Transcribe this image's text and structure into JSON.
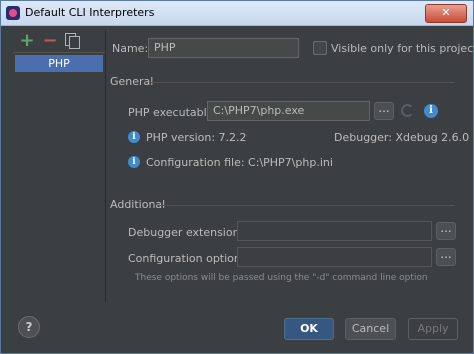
{
  "window": {
    "title": "Default CLI Interpreters",
    "close_glyph": "✕"
  },
  "toolbar": {
    "add_icon": "plus-icon",
    "remove_icon": "minus-icon",
    "copy_icon": "copy-icon"
  },
  "interpreters": [
    {
      "label": "PHP"
    }
  ],
  "form": {
    "name_label": "Name:",
    "name_value": "PHP",
    "visible_only_label": "Visible only for this project",
    "visible_only_checked": false,
    "general_heading": "General",
    "php_executable_label": "PHP executable:",
    "php_executable_value": "C:\\PHP7\\php.exe",
    "php_version": "PHP version: 7.2.2",
    "debugger": "Debugger: Xdebug 2.6.0",
    "config_file": "Configuration file: C:\\PHP7\\php.ini",
    "additional_heading": "Additional",
    "debugger_extension_label": "Debugger extension:",
    "debugger_extension_value": "",
    "configuration_options_label": "Configuration options:",
    "configuration_options_value": "",
    "hint": "These options will be passed using the \"-d\" command line option",
    "browse_label": "..."
  },
  "buttons": {
    "help": "?",
    "ok": "OK",
    "cancel": "Cancel",
    "apply": "Apply"
  },
  "colors": {
    "background": "#3c3f41",
    "selection": "#4b6eaf",
    "accent_ok": "#365880",
    "info": "#3f8ccd"
  }
}
